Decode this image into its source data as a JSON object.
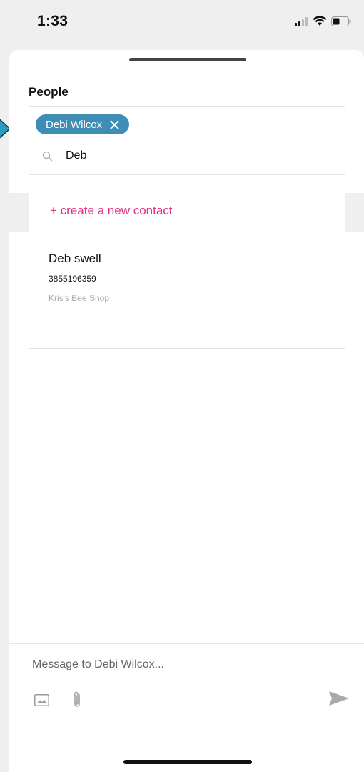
{
  "status_bar": {
    "time": "1:33"
  },
  "people": {
    "label": "People",
    "selected_chip": "Debi Wilcox",
    "search_value": "Deb"
  },
  "dropdown": {
    "create_contact_label": "+ create a new contact",
    "results": [
      {
        "name": "Deb swell",
        "phone": "3855196359",
        "company": "Kris's Bee Shop"
      }
    ]
  },
  "composer": {
    "placeholder": "Message to Debi Wilcox..."
  },
  "colors": {
    "chip": "#3d8db5",
    "create_contact": "#e0308a",
    "background": "#efefef"
  }
}
